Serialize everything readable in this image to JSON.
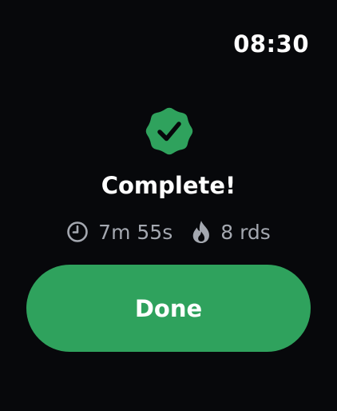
{
  "status_bar": {
    "time": "08:30"
  },
  "summary": {
    "badge_icon": "verified-check-badge-icon",
    "title": "Complete!",
    "duration": {
      "icon": "clock-icon",
      "value": "7m 55s"
    },
    "rounds": {
      "icon": "flame-icon",
      "value": "8 rds"
    }
  },
  "actions": {
    "done_label": "Done"
  },
  "colors": {
    "background": "#07080b",
    "accent_green": "#2fa25d",
    "secondary_text": "#a4a8b0"
  }
}
